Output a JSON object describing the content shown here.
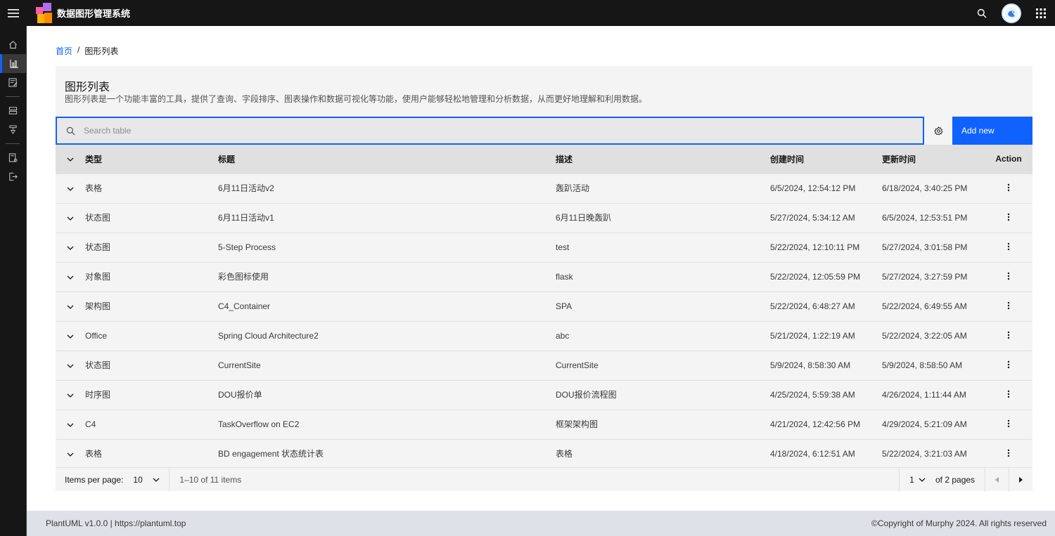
{
  "header": {
    "title": "数据图形管理系统",
    "icons": [
      "menu-icon",
      "logo-icon",
      "search-icon",
      "avatar",
      "app-switcher-icon"
    ]
  },
  "sidebar": {
    "items": [
      "home-icon",
      "chart-icon",
      "edit-list-icon",
      "storage-icon",
      "flow-icon",
      "document-settings-icon",
      "logout-icon"
    ]
  },
  "breadcrumb": {
    "home": "首页",
    "separator": "/",
    "current": "图形列表"
  },
  "panel": {
    "title": "图形列表",
    "description": "图形列表是一个功能丰富的工具，提供了查询、字段排序、图表操作和数据可视化等功能，使用户能够轻松地管理和分析数据，从而更好地理解和利用数据。"
  },
  "toolbar": {
    "search_placeholder": "Search table",
    "add_label": "Add new"
  },
  "table": {
    "columns": {
      "type": "类型",
      "title": "标题",
      "desc": "描述",
      "created": "创建时间",
      "updated": "更新时间",
      "action": "Action"
    },
    "rows": [
      {
        "type": "表格",
        "title": "6月11日活动v2",
        "desc": "轰趴活动",
        "created": "6/5/2024, 12:54:12 PM",
        "updated": "6/18/2024, 3:40:25 PM"
      },
      {
        "type": "状态图",
        "title": "6月11日活动v1",
        "desc": "6月11日晚轰趴",
        "created": "5/27/2024, 5:34:12 AM",
        "updated": "6/5/2024, 12:53:51 PM"
      },
      {
        "type": "状态图",
        "title": "5-Step Process",
        "desc": "test",
        "created": "5/22/2024, 12:10:11 PM",
        "updated": "5/27/2024, 3:01:58 PM"
      },
      {
        "type": "对象图",
        "title": "彩色图标使用",
        "desc": "flask",
        "created": "5/22/2024, 12:05:59 PM",
        "updated": "5/27/2024, 3:27:59 PM"
      },
      {
        "type": "架构图",
        "title": "C4_Container",
        "desc": "SPA",
        "created": "5/22/2024, 6:48:27 AM",
        "updated": "5/22/2024, 6:49:55 AM"
      },
      {
        "type": "Office",
        "title": "Spring Cloud Architecture2",
        "desc": "abc",
        "created": "5/21/2024, 1:22:19 AM",
        "updated": "5/22/2024, 3:22:05 AM"
      },
      {
        "type": "状态图",
        "title": "CurrentSite",
        "desc": "CurrentSite",
        "created": "5/9/2024, 8:58:30 AM",
        "updated": "5/9/2024, 8:58:50 AM"
      },
      {
        "type": "时序图",
        "title": "DOU报价单",
        "desc": "DOU报价流程图",
        "created": "4/25/2024, 5:59:38 AM",
        "updated": "4/26/2024, 1:11:44 AM"
      },
      {
        "type": "C4",
        "title": "TaskOverflow on EC2",
        "desc": "框架架构图",
        "created": "4/21/2024, 12:42:56 PM",
        "updated": "4/29/2024, 5:21:09 AM"
      },
      {
        "type": "表格",
        "title": "BD engagement 状态统计表",
        "desc": "表格",
        "created": "4/18/2024, 6:12:51 AM",
        "updated": "5/22/2024, 3:21:03 AM"
      }
    ]
  },
  "pagination": {
    "items_per_page_label": "Items per page:",
    "page_size": "10",
    "range": "1–10 of 11 items",
    "page": "1",
    "of_pages": "of 2 pages"
  },
  "footer": {
    "left": "PlantUML v1.0.0 | https://plantuml.top",
    "right": "©Copyright of Murphy 2024. All rights reserved"
  },
  "colors": {
    "header_bg": "#161616",
    "accent": "#0f62fe",
    "panel_bg": "#f4f4f4",
    "table_header_bg": "#e0e0e0",
    "footer_bg": "#dfe1e8"
  }
}
